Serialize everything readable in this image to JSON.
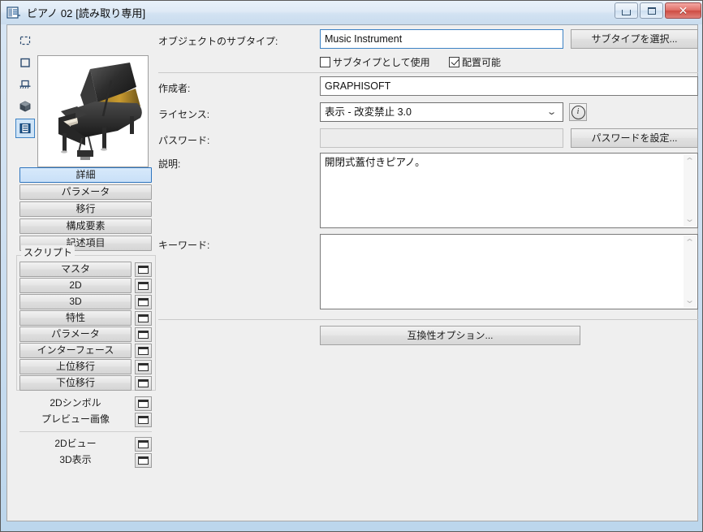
{
  "window": {
    "title": "ピアノ 02 [読み取り専用]",
    "app_icon": "object-editor-icon",
    "buttons": {
      "minimize": "–",
      "maximize": "□",
      "close": "✕"
    }
  },
  "toolstrip": {
    "items": [
      {
        "name": "dashed-rect-icon",
        "selected": false
      },
      {
        "name": "square-icon",
        "selected": false
      },
      {
        "name": "section-icon",
        "selected": false
      },
      {
        "name": "cube-icon",
        "selected": false
      },
      {
        "name": "details-icon",
        "selected": true
      }
    ]
  },
  "preview": {
    "alt": "grand-piano-preview"
  },
  "nav": {
    "items": [
      {
        "label": "詳細",
        "selected": true
      },
      {
        "label": "パラメータ",
        "selected": false
      },
      {
        "label": "移行",
        "selected": false
      },
      {
        "label": "構成要素",
        "selected": false
      },
      {
        "label": "記述項目",
        "selected": false
      }
    ]
  },
  "scripts": {
    "group_label": "スクリプト",
    "items": [
      {
        "label": "マスタ",
        "icon": "window-icon"
      },
      {
        "label": "2D",
        "icon": "window-icon"
      },
      {
        "label": "3D",
        "icon": "window-icon"
      },
      {
        "label": "特性",
        "icon": "window-icon"
      },
      {
        "label": "パラメータ",
        "icon": "window-icon"
      },
      {
        "label": "インターフェース",
        "icon": "window-icon"
      },
      {
        "label": "上位移行",
        "icon": "window-icon"
      },
      {
        "label": "下位移行",
        "icon": "window-icon"
      }
    ]
  },
  "views": {
    "group_a": [
      {
        "label": "2Dシンボル",
        "icon": "window-icon"
      },
      {
        "label": "プレビュー画像",
        "icon": "window-icon"
      }
    ],
    "group_b": [
      {
        "label": "2Dビュー",
        "icon": "window-icon"
      },
      {
        "label": "3D表示",
        "icon": "window-icon"
      }
    ]
  },
  "details": {
    "subtype": {
      "label": "オブジェクトのサブタイプ:",
      "value": "Music Instrument",
      "select_button": "サブタイプを選択..."
    },
    "use_as_subtype": {
      "label": "サブタイプとして使用",
      "checked": false
    },
    "placeable": {
      "label": "配置可能",
      "checked": true
    },
    "author": {
      "label": "作成者:",
      "value": "GRAPHISOFT"
    },
    "license": {
      "label": "ライセンス:",
      "value": "表示 - 改変禁止 3.0",
      "chevron": "⌄",
      "info_icon": "info-icon",
      "info_glyph": "i"
    },
    "password": {
      "label": "パスワード:",
      "value": "",
      "set_button": "パスワードを設定..."
    },
    "description": {
      "label": "説明:",
      "value": "開閉式蓋付きピアノ。"
    },
    "keywords": {
      "label": "キーワード:",
      "value": ""
    },
    "compatibility_button": "互換性オプション...",
    "scroll_up": "⌃",
    "scroll_down": "⌄"
  }
}
